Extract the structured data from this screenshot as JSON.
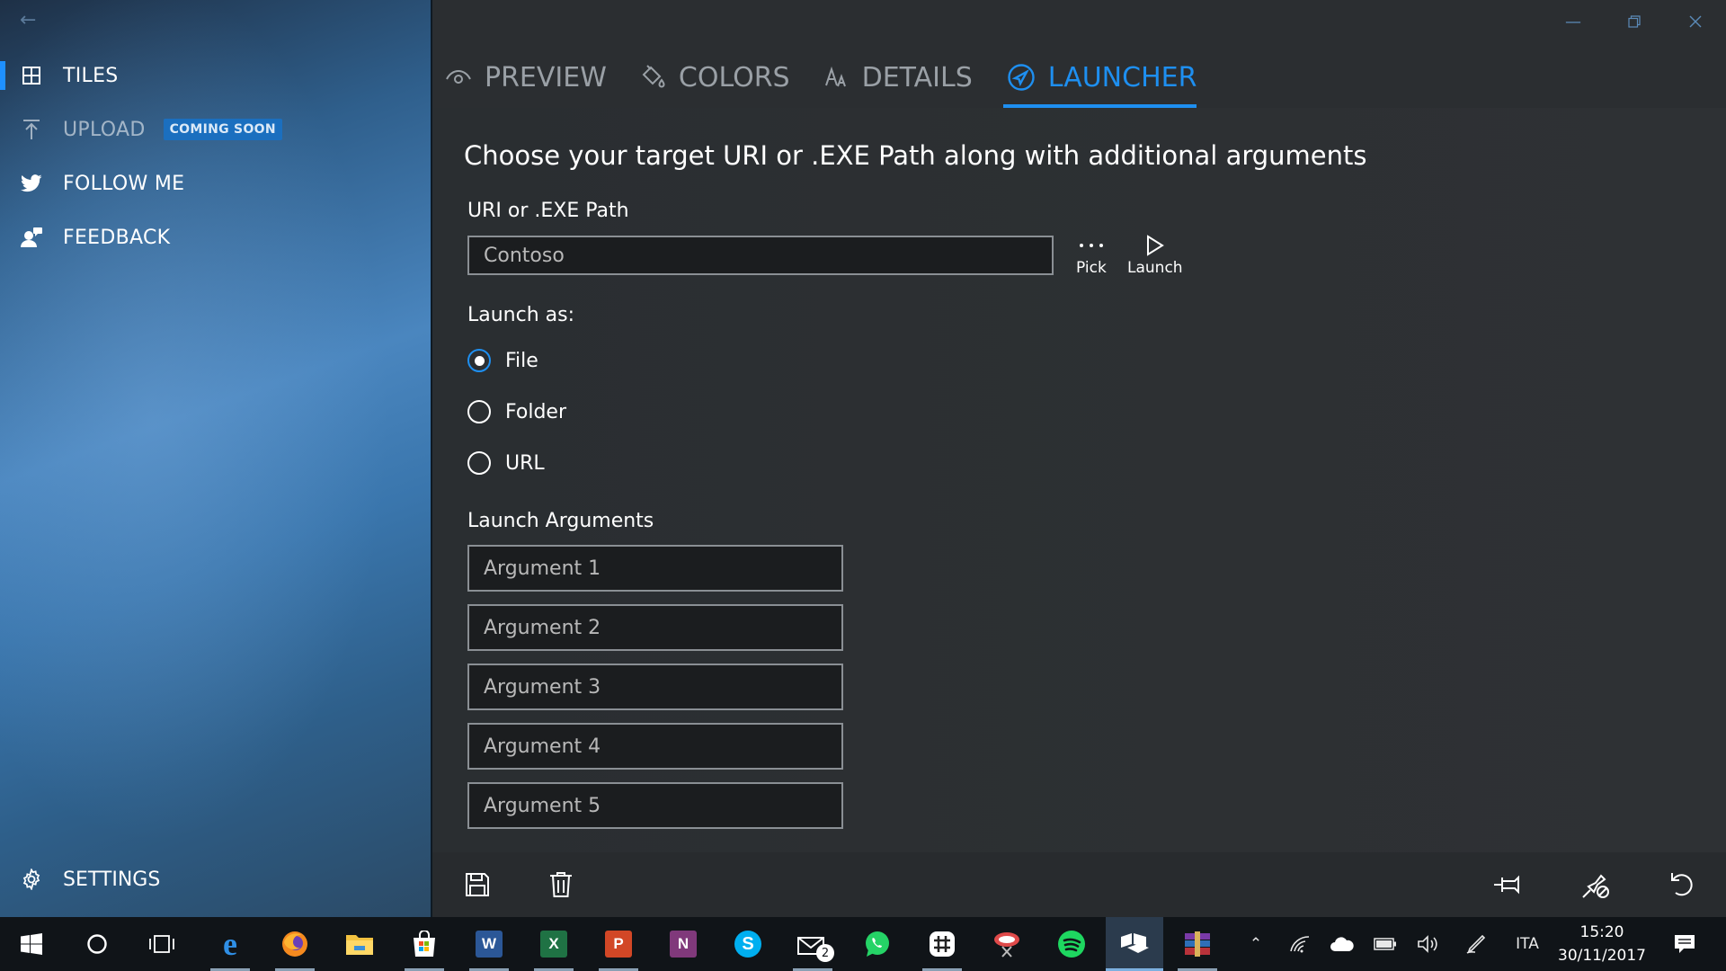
{
  "sidebar": {
    "items": [
      {
        "label": "TILES",
        "icon": "tiles-grid-icon"
      },
      {
        "label": "UPLOAD",
        "icon": "upload-icon",
        "badge": "COMING SOON"
      },
      {
        "label": "FOLLOW ME",
        "icon": "twitter-icon"
      },
      {
        "label": "FEEDBACK",
        "icon": "feedback-icon"
      }
    ],
    "settings_label": "SETTINGS"
  },
  "tabs": [
    {
      "label": "PREVIEW",
      "icon": "eye-icon"
    },
    {
      "label": "COLORS",
      "icon": "paint-bucket-icon"
    },
    {
      "label": "DETAILS",
      "icon": "font-size-icon"
    },
    {
      "label": "LAUNCHER",
      "icon": "rocket-icon",
      "active": true
    }
  ],
  "launcher": {
    "heading": "Choose your target URI or .EXE Path along with additional arguments",
    "uri_label": "URI or .EXE Path",
    "uri_placeholder": "Contoso",
    "pick_label": "Pick",
    "launch_label": "Launch",
    "launch_as_label": "Launch as:",
    "options": [
      "File",
      "Folder",
      "URL"
    ],
    "selected_option": "File",
    "arguments_label": "Launch Arguments",
    "argument_placeholders": [
      "Argument 1",
      "Argument 2",
      "Argument 3",
      "Argument 4",
      "Argument 5"
    ]
  },
  "taskbar": {
    "mail_badge": "2",
    "language": "ITA",
    "time": "15:20",
    "date": "30/11/2017"
  },
  "colors": {
    "accent": "#1e8ff0",
    "badge": "#1b6fbf"
  }
}
